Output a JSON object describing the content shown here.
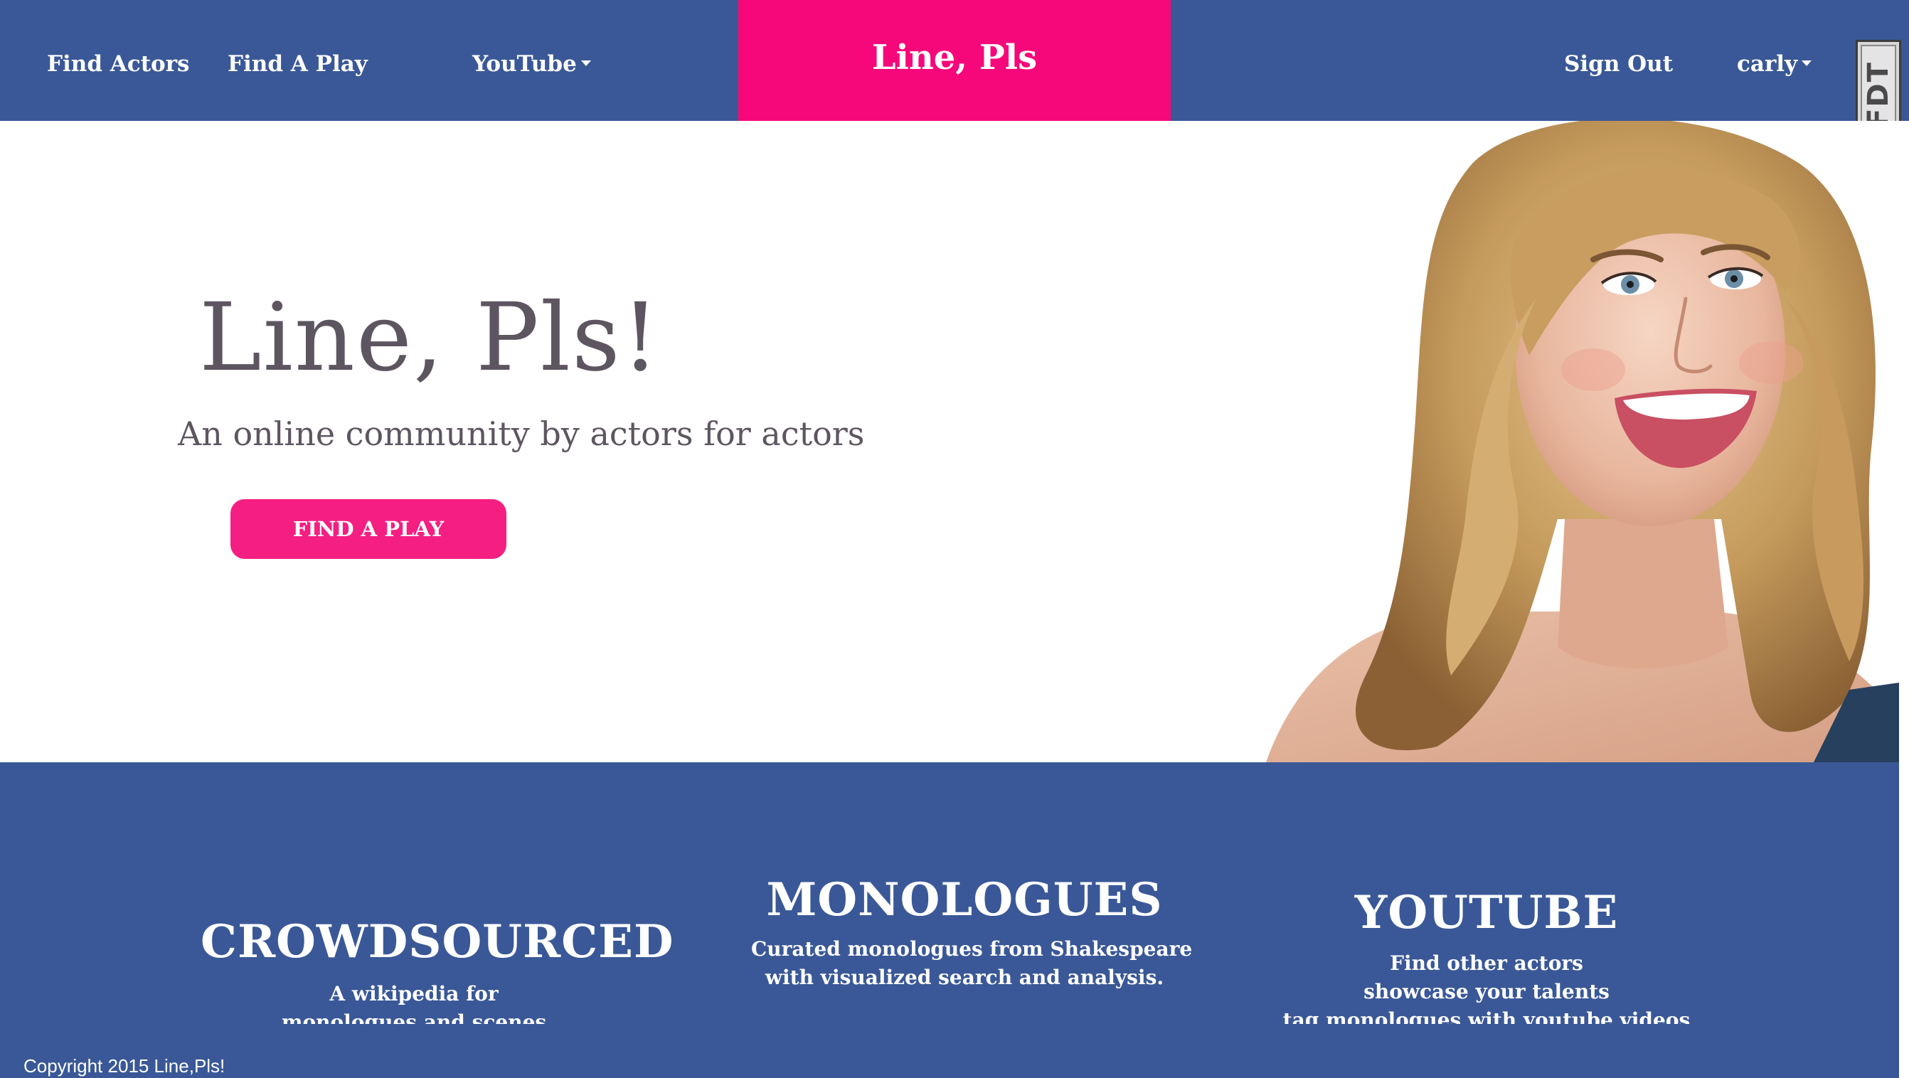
{
  "navbar": {
    "find_actors": "Find Actors",
    "find_a_play": "Find A Play",
    "youtube": "YouTube",
    "brand": "Line, Pls",
    "sign_out": "Sign Out",
    "user": "carly"
  },
  "devtool": {
    "label": "FDT"
  },
  "hero": {
    "title": "Line, Pls!",
    "subtitle": "An online community by actors for actors",
    "cta_label": "FIND A PLAY"
  },
  "features": [
    {
      "title": "CROWDSOURCED",
      "lines": [
        "A wikipedia for",
        "monologues and scenes"
      ]
    },
    {
      "title": "MONOLOGUES",
      "lines": [
        "Curated monologues from Shakespeare",
        "with visualized search and analysis."
      ]
    },
    {
      "title": "YOUTUBE",
      "lines": [
        "Find other actors",
        "showcase your talents",
        "tag monologues with youtube videos"
      ]
    }
  ],
  "footer": {
    "copyright": "Copyright 2015 Line,Pls!"
  },
  "colors": {
    "nav_blue": "#3a5897",
    "brand_pink": "#f7087a",
    "cta_pink": "#f51f82",
    "hero_text": "#5d5560"
  }
}
